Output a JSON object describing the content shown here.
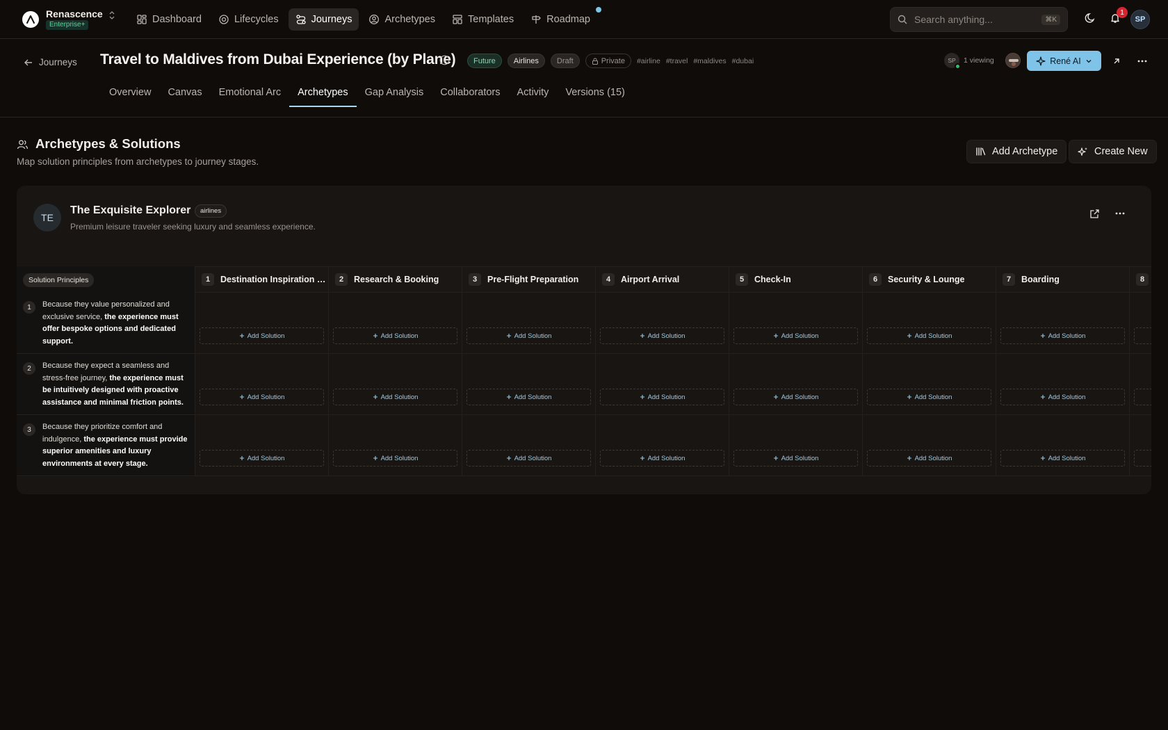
{
  "brand": {
    "name": "Renascence",
    "plan": "Enterprise+"
  },
  "nav": [
    {
      "label": "Dashboard",
      "icon": "dashboard-icon",
      "active": false
    },
    {
      "label": "Lifecycles",
      "icon": "lifecycle-icon",
      "active": false
    },
    {
      "label": "Journeys",
      "icon": "journeys-icon",
      "active": true
    },
    {
      "label": "Archetypes",
      "icon": "user-circle-icon",
      "active": false
    },
    {
      "label": "Templates",
      "icon": "templates-icon",
      "active": false
    },
    {
      "label": "Roadmap",
      "icon": "signpost-icon",
      "active": false
    }
  ],
  "search": {
    "placeholder": "Search anything...",
    "shortcut": "⌘K"
  },
  "notifications": {
    "count": "1"
  },
  "user": {
    "initials": "SP"
  },
  "journey": {
    "back_label": "Journeys",
    "title": "Travel to Maldives from Dubai Experience (by Plane)",
    "tags": {
      "future": "Future",
      "airlines": "Airlines",
      "draft": "Draft",
      "private": "Private"
    },
    "hashtags": [
      "#airline",
      "#travel",
      "#maldives",
      "#dubai"
    ],
    "viewer_initials": "SP",
    "viewing": "1 viewing",
    "ai_button": "René AI"
  },
  "tabs": [
    {
      "label": "Overview",
      "active": false
    },
    {
      "label": "Canvas",
      "active": false
    },
    {
      "label": "Emotional Arc",
      "active": false
    },
    {
      "label": "Archetypes",
      "active": true
    },
    {
      "label": "Gap Analysis",
      "active": false
    },
    {
      "label": "Collaborators",
      "active": false
    },
    {
      "label": "Activity",
      "active": false
    },
    {
      "label": "Versions (15)",
      "active": false
    }
  ],
  "section": {
    "title": "Archetypes & Solutions",
    "subtitle": "Map solution principles from archetypes to journey stages.",
    "add_archetype": "Add Archetype",
    "create_new": "Create New"
  },
  "archetype": {
    "initials": "TE",
    "name": "The Exquisite Explorer",
    "tag": "airlines",
    "description": "Premium leisure traveler seeking luxury and seamless experience."
  },
  "matrix": {
    "principles_label": "Solution Principles",
    "add_solution": "Add Solution",
    "stages": [
      {
        "num": "1",
        "name": "Destination Inspiration & Planning"
      },
      {
        "num": "2",
        "name": "Research & Booking"
      },
      {
        "num": "3",
        "name": "Pre-Flight Preparation"
      },
      {
        "num": "4",
        "name": "Airport Arrival"
      },
      {
        "num": "5",
        "name": "Check-In"
      },
      {
        "num": "6",
        "name": "Security & Lounge"
      },
      {
        "num": "7",
        "name": "Boarding"
      },
      {
        "num": "8",
        "name": ""
      }
    ],
    "principles": [
      {
        "num": "1",
        "lead": "Because they value personalized and exclusive service, ",
        "bold": "the experience must offer bespoke options and dedicated support."
      },
      {
        "num": "2",
        "lead": "Because they expect a seamless and stress-free journey, ",
        "bold": "the experience must be intuitively designed with proactive assistance and minimal friction points."
      },
      {
        "num": "3",
        "lead": "Because they prioritize comfort and indulgence, ",
        "bold": "the experience must provide superior amenities and luxury environments at every stage."
      }
    ]
  },
  "colors": {
    "accent": "#7fc4e8",
    "online": "#2fbf6b",
    "badge": "#d6252e"
  }
}
